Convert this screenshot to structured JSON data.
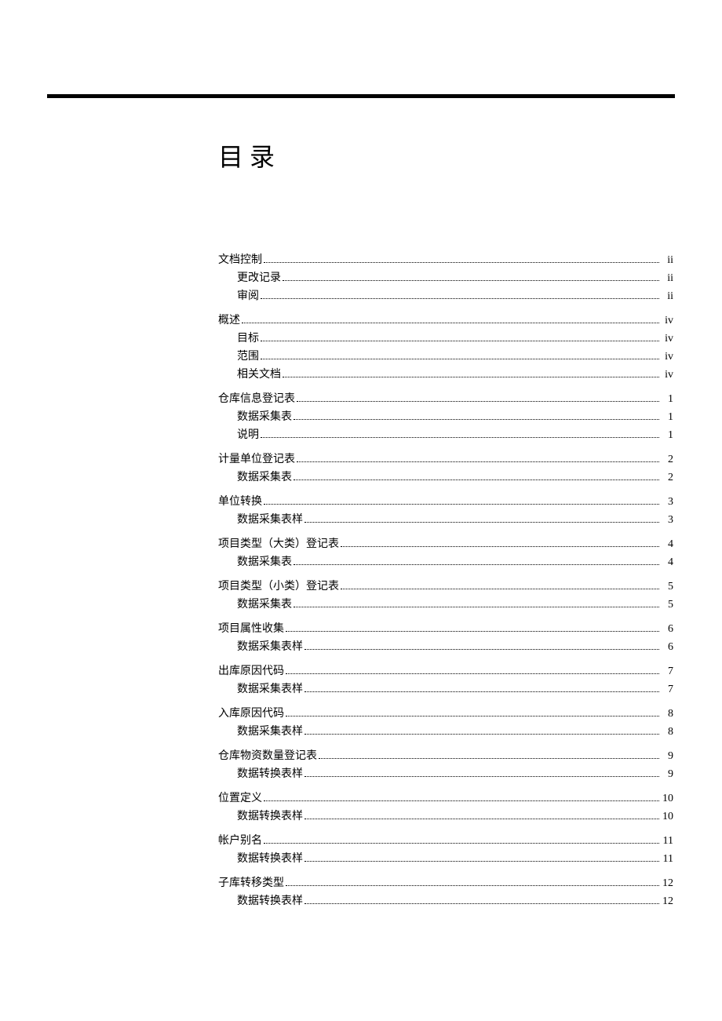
{
  "title": "目录",
  "toc": [
    {
      "level": 1,
      "label": "文档控制",
      "page": "ii"
    },
    {
      "level": 2,
      "label": "更改记录",
      "page": "ii"
    },
    {
      "level": 2,
      "label": "审阅",
      "page": "ii"
    },
    {
      "level": 1,
      "label": "概述",
      "page": "iv"
    },
    {
      "level": 2,
      "label": "目标",
      "page": "iv"
    },
    {
      "level": 2,
      "label": "范围",
      "page": "iv"
    },
    {
      "level": 2,
      "label": "相关文档",
      "page": "iv"
    },
    {
      "level": 1,
      "label": "仓库信息登记表",
      "page": "1"
    },
    {
      "level": 2,
      "label": "数据采集表",
      "page": "1"
    },
    {
      "level": 2,
      "label": "说明",
      "page": "1"
    },
    {
      "level": 1,
      "label": "计量单位登记表",
      "page": "2"
    },
    {
      "level": 2,
      "label": "数据采集表",
      "page": "2"
    },
    {
      "level": 1,
      "label": "单位转换",
      "page": "3"
    },
    {
      "level": 2,
      "label": "数据采集表样",
      "page": "3"
    },
    {
      "level": 1,
      "label": "项目类型（大类）登记表",
      "page": "4"
    },
    {
      "level": 2,
      "label": "数据采集表",
      "page": "4"
    },
    {
      "level": 1,
      "label": "项目类型（小类）登记表",
      "page": "5"
    },
    {
      "level": 2,
      "label": "数据采集表",
      "page": "5"
    },
    {
      "level": 1,
      "label": "项目属性收集",
      "page": "6"
    },
    {
      "level": 2,
      "label": "数据采集表样",
      "page": "6"
    },
    {
      "level": 1,
      "label": "出库原因代码",
      "page": "7"
    },
    {
      "level": 2,
      "label": "数据采集表样",
      "page": "7"
    },
    {
      "level": 1,
      "label": "入库原因代码",
      "page": "8"
    },
    {
      "level": 2,
      "label": "数据采集表样",
      "page": "8"
    },
    {
      "level": 1,
      "label": "仓库物资数量登记表",
      "page": "9"
    },
    {
      "level": 2,
      "label": "数据转换表样",
      "page": "9"
    },
    {
      "level": 1,
      "label": "位置定义",
      "page": "10"
    },
    {
      "level": 2,
      "label": "数据转换表样",
      "page": "10"
    },
    {
      "level": 1,
      "label": "帐户别名",
      "page": "11"
    },
    {
      "level": 2,
      "label": "数据转换表样",
      "page": "11"
    },
    {
      "level": 1,
      "label": "子库转移类型",
      "page": "12"
    },
    {
      "level": 2,
      "label": "数据转换表样",
      "page": "12"
    }
  ]
}
